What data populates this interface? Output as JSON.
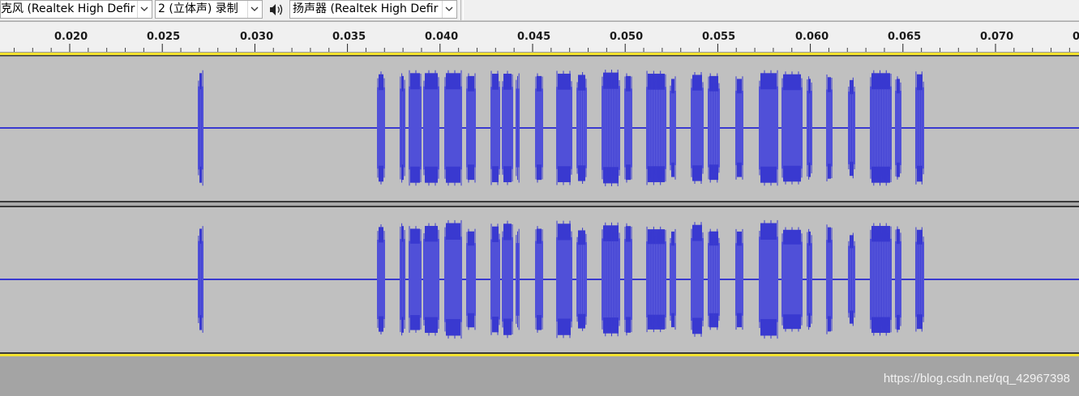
{
  "toolbar": {
    "recording_device": "克风 (Realtek High Defir",
    "channels": "2 (立体声) 录制",
    "speaker_icon": "speaker-icon",
    "playback_device": "扬声器 (Realtek High Defir",
    "dropdown_icon": "chevron-down-icon"
  },
  "ruler": {
    "labels": [
      "0.020",
      "0.025",
      "0.030",
      "0.035",
      "0.040",
      "0.045",
      "0.050",
      "0.055",
      "0.060",
      "0.065",
      "0.070",
      "0"
    ]
  },
  "track": {
    "channels": 2,
    "wave_color": "#6666e0",
    "peak_color": "#3939d0",
    "background": "#c0c0c0",
    "selection_edge_color": "#f3e22f"
  },
  "watermark": "https://blog.csdn.net/qq_42967398"
}
